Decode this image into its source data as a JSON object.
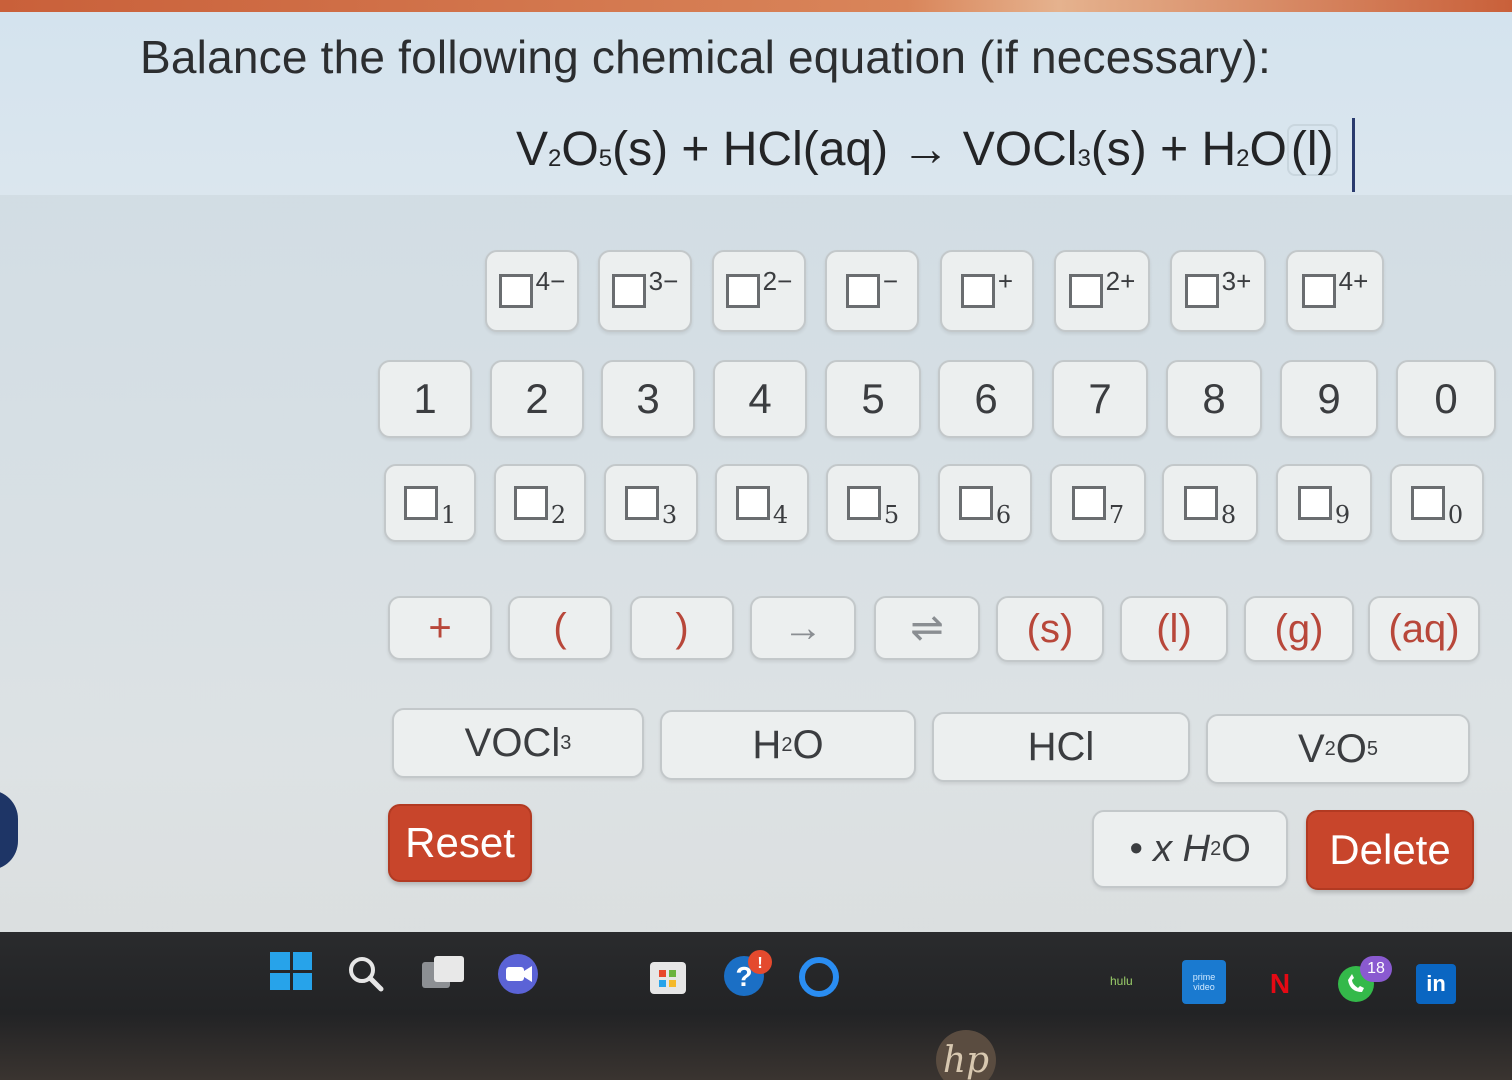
{
  "question": {
    "prompt": "Balance the following chemical equation (if necessary):",
    "eq_part1": "V",
    "eq_sub1": "2",
    "eq_part2": "O",
    "eq_sub2": "5",
    "eq_part3": "(s) + HCl(aq) → VOCl",
    "eq_sub3": "3",
    "eq_part4": "(s) + H",
    "eq_sub4": "2",
    "eq_part5": "O",
    "eq_state_last": "(l)"
  },
  "charge_keys": [
    {
      "sup": "4−"
    },
    {
      "sup": "3−"
    },
    {
      "sup": "2−"
    },
    {
      "sup": "−"
    },
    {
      "sup": "+"
    },
    {
      "sup": "2+"
    },
    {
      "sup": "3+"
    },
    {
      "sup": "4+"
    }
  ],
  "number_keys": [
    "1",
    "2",
    "3",
    "4",
    "5",
    "6",
    "7",
    "8",
    "9",
    "0"
  ],
  "subscript_keys": [
    "1",
    "2",
    "3",
    "4",
    "5",
    "6",
    "7",
    "8",
    "9",
    "0"
  ],
  "symbol_keys": [
    "+",
    "(",
    ")",
    "→",
    "⇌",
    "(s)",
    "(l)",
    "(g)",
    "(aq)"
  ],
  "species_keys": [
    {
      "main": "VOCl",
      "sub": "3",
      "tail": ""
    },
    {
      "main": "H",
      "sub": "2",
      "tail": "O"
    },
    {
      "main": "HCl",
      "sub": "",
      "tail": ""
    },
    {
      "main": "V",
      "sub": "2",
      "tail": "O",
      "sub2": "5"
    }
  ],
  "actions": {
    "reset": "Reset",
    "hydrate": "• x H",
    "hydrate_sub": "2",
    "hydrate_tail": "O",
    "delete": "Delete"
  },
  "taskbar": {
    "hulu_label": "hulu",
    "prime_label": "prime video",
    "netflix_label": "N",
    "whatsapp_badge": "18",
    "linkedin_label": "in",
    "hp_label": "hp"
  }
}
